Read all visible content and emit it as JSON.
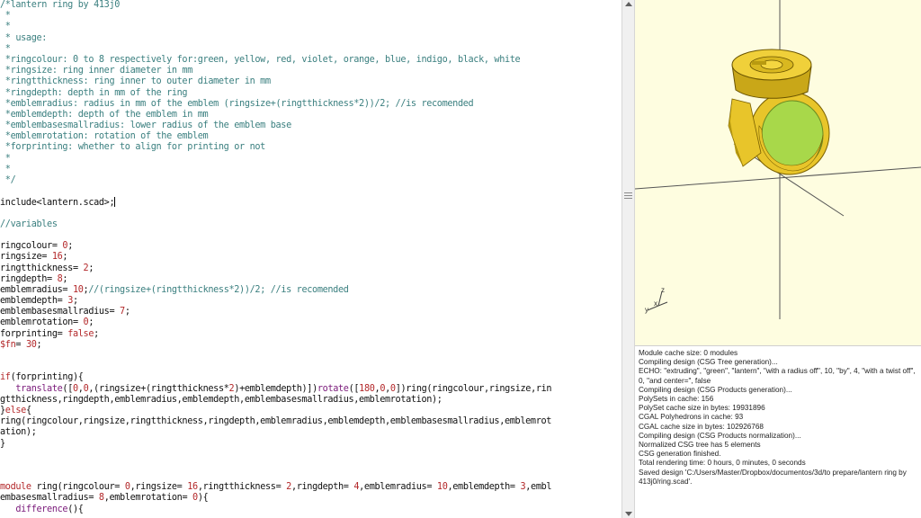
{
  "editor": {
    "lines": [
      [
        {
          "t": "/*lantern ring by 413j0",
          "c": "c-comment"
        }
      ],
      [
        {
          "t": " *",
          "c": "c-comment"
        }
      ],
      [
        {
          "t": " *",
          "c": "c-comment"
        }
      ],
      [
        {
          "t": " * usage:",
          "c": "c-comment"
        }
      ],
      [
        {
          "t": " *",
          "c": "c-comment"
        }
      ],
      [
        {
          "t": " *ringcolour: 0 to 8 respectively for:green, yellow, red, violet, orange, blue, indigo, black, white",
          "c": "c-comment"
        }
      ],
      [
        {
          "t": " *ringsize: ring inner diameter in mm",
          "c": "c-comment"
        }
      ],
      [
        {
          "t": " *ringtthickness: ring inner to outer diameter in mm",
          "c": "c-comment"
        }
      ],
      [
        {
          "t": " *ringdepth: depth in mm of the ring",
          "c": "c-comment"
        }
      ],
      [
        {
          "t": " *emblemradius: radius in mm of the emblem (ringsize+(ringtthickness*2))/2; //is recomended",
          "c": "c-comment"
        }
      ],
      [
        {
          "t": " *emblemdepth: depth of the emblem in mm",
          "c": "c-comment"
        }
      ],
      [
        {
          "t": " *emblembasesmallradius: lower radius of the emblem base",
          "c": "c-comment"
        }
      ],
      [
        {
          "t": " *emblemrotation: rotation of the emblem",
          "c": "c-comment"
        }
      ],
      [
        {
          "t": " *forprinting: whether to align for printing or not",
          "c": "c-comment"
        }
      ],
      [
        {
          "t": " *",
          "c": "c-comment"
        }
      ],
      [
        {
          "t": " *",
          "c": "c-comment"
        }
      ],
      [
        {
          "t": " */",
          "c": "c-comment"
        }
      ],
      [],
      [
        {
          "t": "include<lantern.scad>;",
          "c": "c-code"
        },
        {
          "caret": true
        }
      ],
      [],
      [
        {
          "t": "//variables",
          "c": "c-comment"
        }
      ],
      [],
      [
        {
          "t": "ringcolour= ",
          "c": "c-var"
        },
        {
          "t": "0",
          "c": "c-num"
        },
        {
          "t": ";",
          "c": "c-code"
        }
      ],
      [
        {
          "t": "ringsize= ",
          "c": "c-var"
        },
        {
          "t": "16",
          "c": "c-num"
        },
        {
          "t": ";",
          "c": "c-code"
        }
      ],
      [
        {
          "t": "ringtthickness= ",
          "c": "c-var"
        },
        {
          "t": "2",
          "c": "c-num"
        },
        {
          "t": ";",
          "c": "c-code"
        }
      ],
      [
        {
          "t": "ringdepth= ",
          "c": "c-var"
        },
        {
          "t": "8",
          "c": "c-num"
        },
        {
          "t": ";",
          "c": "c-code"
        }
      ],
      [
        {
          "t": "emblemradius= ",
          "c": "c-var"
        },
        {
          "t": "10",
          "c": "c-num"
        },
        {
          "t": ";",
          "c": "c-code"
        },
        {
          "t": "//(ringsize+(ringtthickness*2))/2; //is recomended",
          "c": "c-comment"
        }
      ],
      [
        {
          "t": "emblemdepth= ",
          "c": "c-var"
        },
        {
          "t": "3",
          "c": "c-num"
        },
        {
          "t": ";",
          "c": "c-code"
        }
      ],
      [
        {
          "t": "emblembasesmallradius= ",
          "c": "c-var"
        },
        {
          "t": "7",
          "c": "c-num"
        },
        {
          "t": ";",
          "c": "c-code"
        }
      ],
      [
        {
          "t": "emblemrotation= ",
          "c": "c-var"
        },
        {
          "t": "0",
          "c": "c-num"
        },
        {
          "t": ";",
          "c": "c-code"
        }
      ],
      [
        {
          "t": "forprinting= ",
          "c": "c-var"
        },
        {
          "t": "false",
          "c": "c-num"
        },
        {
          "t": ";",
          "c": "c-code"
        }
      ],
      [
        {
          "t": "$fn",
          "c": "c-num"
        },
        {
          "t": "= ",
          "c": "c-code"
        },
        {
          "t": "30",
          "c": "c-num"
        },
        {
          "t": ";",
          "c": "c-code"
        }
      ],
      [],
      [],
      [
        {
          "t": "if",
          "c": "c-num"
        },
        {
          "t": "(forprinting){",
          "c": "c-code"
        }
      ],
      [
        {
          "t": "   translate",
          "c": "c-kw"
        },
        {
          "t": "([",
          "c": "c-code"
        },
        {
          "t": "0",
          "c": "c-num"
        },
        {
          "t": ",",
          "c": "c-code"
        },
        {
          "t": "0",
          "c": "c-num"
        },
        {
          "t": ",(ringsize+(ringtthickness*",
          "c": "c-code"
        },
        {
          "t": "2",
          "c": "c-num"
        },
        {
          "t": ")+emblemdepth)])",
          "c": "c-code"
        },
        {
          "t": "rotate",
          "c": "c-kw"
        },
        {
          "t": "([",
          "c": "c-code"
        },
        {
          "t": "180",
          "c": "c-num"
        },
        {
          "t": ",",
          "c": "c-code"
        },
        {
          "t": "0",
          "c": "c-num"
        },
        {
          "t": ",",
          "c": "c-code"
        },
        {
          "t": "0",
          "c": "c-num"
        },
        {
          "t": "])ring(ringcolour,ringsize,rin",
          "c": "c-code"
        }
      ],
      [
        {
          "t": "gtthickness,ringdepth,emblemradius,emblemdepth,emblembasesmallradius,emblemrotation);",
          "c": "c-code"
        }
      ],
      [
        {
          "t": "}",
          "c": "c-code"
        },
        {
          "t": "else",
          "c": "c-num"
        },
        {
          "t": "{",
          "c": "c-code"
        }
      ],
      [
        {
          "t": "ring(ringcolour,ringsize,ringtthickness,ringdepth,emblemradius,emblemdepth,emblembasesmallradius,emblemrot",
          "c": "c-code"
        }
      ],
      [
        {
          "t": "ation);",
          "c": "c-code"
        }
      ],
      [
        {
          "t": "}",
          "c": "c-code"
        }
      ],
      [],
      [],
      [],
      [
        {
          "t": "module",
          "c": "c-num"
        },
        {
          "t": " ring(ringcolour= ",
          "c": "c-code"
        },
        {
          "t": "0",
          "c": "c-num"
        },
        {
          "t": ",ringsize= ",
          "c": "c-code"
        },
        {
          "t": "16",
          "c": "c-num"
        },
        {
          "t": ",ringtthickness= ",
          "c": "c-code"
        },
        {
          "t": "2",
          "c": "c-num"
        },
        {
          "t": ",ringdepth= ",
          "c": "c-code"
        },
        {
          "t": "4",
          "c": "c-num"
        },
        {
          "t": ",emblemradius= ",
          "c": "c-code"
        },
        {
          "t": "10",
          "c": "c-num"
        },
        {
          "t": ",emblemdepth= ",
          "c": "c-code"
        },
        {
          "t": "3",
          "c": "c-num"
        },
        {
          "t": ",embl",
          "c": "c-code"
        }
      ],
      [
        {
          "t": "embasesmallradius= ",
          "c": "c-code"
        },
        {
          "t": "8",
          "c": "c-num"
        },
        {
          "t": ",emblemrotation= ",
          "c": "c-code"
        },
        {
          "t": "0",
          "c": "c-num"
        },
        {
          "t": "){",
          "c": "c-code"
        }
      ],
      [
        {
          "t": "   difference",
          "c": "c-kw"
        },
        {
          "t": "(){",
          "c": "c-code"
        }
      ]
    ]
  },
  "console": {
    "lines": [
      "Module cache size: 0 modules",
      "Compiling design (CSG Tree generation)...",
      "ECHO: \"extruding\", \"green\", \"lantern\", \"with a radius off\", 10, \"by\", 4, \"with a twist off\",",
      "0, \"and center=\", false",
      "Compiling design (CSG Products generation)...",
      "PolySets in cache: 156",
      "PolySet cache size in bytes: 19931896",
      "CGAL Polyhedrons in cache: 93",
      "CGAL cache size in bytes: 102926768",
      "Compiling design (CSG Products normalization)...",
      "Normalized CSG tree has 5 elements",
      "CSG generation finished.",
      "Total rendering time: 0 hours, 0 minutes, 0 seconds",
      "Saved design 'C:/Users/Master/Dropbox/documentos/3d/to prepare/lantern ring by",
      "413j0/ring.scad'."
    ]
  },
  "viewer": {
    "axis_label_z": "z",
    "axis_label_x": "x",
    "axis_label_y": "y",
    "colors": {
      "background": "#fefde0",
      "ring": "#e8c52a",
      "ring_shadow": "#b89a10",
      "inner": "#a8d84a"
    }
  }
}
